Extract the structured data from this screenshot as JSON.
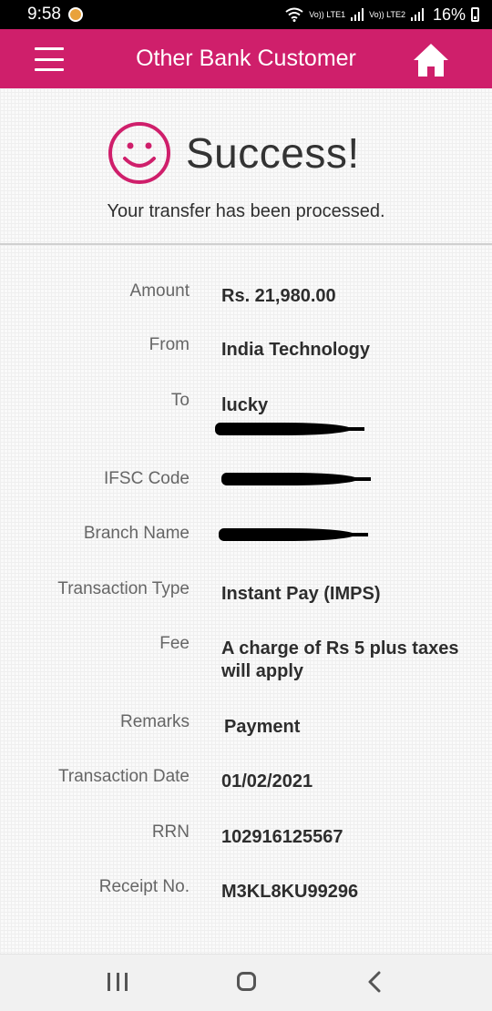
{
  "status_bar": {
    "time": "9:58",
    "sim1": "Vo)) LTE1",
    "sim2": "Vo)) LTE2",
    "battery": "16%"
  },
  "header": {
    "title": "Other Bank Customer",
    "menu_icon": "hamburger-menu-icon",
    "home_icon": "home-icon",
    "color": "#cf1f6b"
  },
  "result": {
    "icon": "smiley-icon",
    "title": "Success!",
    "message": "Your transfer has been processed."
  },
  "details": [
    {
      "label": "Amount",
      "value": "Rs. 21,980.00"
    },
    {
      "label": "From",
      "value": "India Technology"
    },
    {
      "label": "To",
      "value": "lucky"
    },
    {
      "label": "IFSC Code",
      "value": ""
    },
    {
      "label": "Branch Name",
      "value": ""
    },
    {
      "label": "Transaction Type",
      "value": "Instant Pay (IMPS)"
    },
    {
      "label": "Fee",
      "value": "A charge of Rs 5 plus taxes will apply"
    },
    {
      "label": "Remarks",
      "value": "Payment"
    },
    {
      "label": "Transaction Date",
      "value": "01/02/2021"
    },
    {
      "label": "RRN",
      "value": "102916125567"
    },
    {
      "label": "Receipt No.",
      "value": "M3KL8KU99296"
    }
  ],
  "nav_bar": {
    "recents_icon": "recents-icon",
    "home_icon": "home-circle-icon",
    "back_icon": "back-chevron-icon"
  }
}
